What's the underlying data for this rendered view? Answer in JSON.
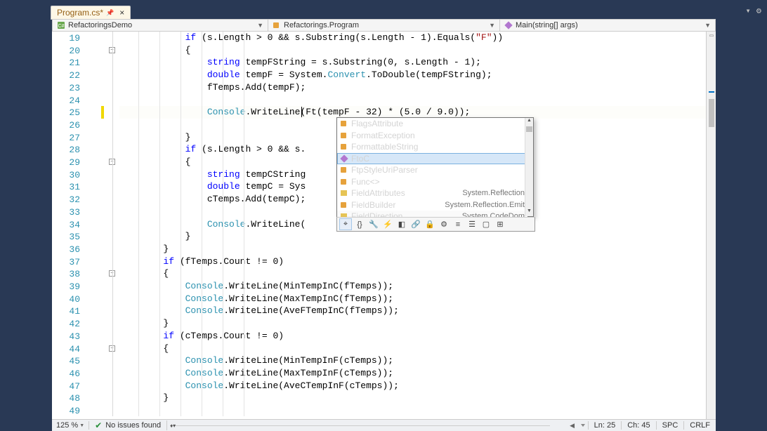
{
  "tab": {
    "name": "Program.cs*",
    "modified": true
  },
  "breadcrumb": {
    "namespace": "RefactoringsDemo",
    "class": "Refactorings.Program",
    "method": "Main(string[] args)"
  },
  "zoom": "125 %",
  "issues": "No issues found",
  "status": {
    "line_label": "Ln:",
    "line": "25",
    "col_label": "Ch:",
    "col": "45",
    "spc": "SPC",
    "crlf": "CRLF"
  },
  "code": {
    "19": "            if (s.Length > 0 && s.Substring(s.Length - 1).Equals(\"F\"))",
    "20": "            {",
    "21": "                string tempFString = s.Substring(0, s.Length - 1);",
    "22": "                double tempF = System.Convert.ToDouble(tempFString);",
    "23": "                fTemps.Add(tempF);",
    "24": "",
    "25": "                Console.WriteLine(Ft|(tempF - 32) * (5.0 / 9.0));",
    "26": "",
    "27": "            }",
    "28": "            if (s.Length > 0 && s.",
    "29": "            {",
    "30": "                string tempCString",
    "31": "                double tempC = Sys",
    "32": "                cTemps.Add(tempC);",
    "33": "",
    "34": "                Console.WriteLine(",
    "35": "            }",
    "36": "        }",
    "37": "        if (fTemps.Count != 0)",
    "38": "        {",
    "39": "            Console.WriteLine(MinTempInC(fTemps));",
    "40": "            Console.WriteLine(MaxTempInC(fTemps));",
    "41": "            Console.WriteLine(AveFTempInC(fTemps));",
    "42": "        }",
    "43": "        if (cTemps.Count != 0)",
    "44": "        {",
    "45": "            Console.WriteLine(MinTempInF(cTemps));",
    "46": "            Console.WriteLine(MaxTempInF(cTemps));",
    "47": "            Console.WriteLine(AveCTempInF(cTemps));",
    "48": "        }",
    "49": ""
  },
  "completion": {
    "items": [
      {
        "label": "FlagsAttribute",
        "icon": "class"
      },
      {
        "label": "FormatException",
        "icon": "class"
      },
      {
        "label": "FormattableString",
        "icon": "class"
      },
      {
        "label": "FtoC",
        "icon": "method",
        "selected": true
      },
      {
        "label": "FtpStyleUriParser",
        "icon": "class"
      },
      {
        "label": "Func<>",
        "icon": "class"
      },
      {
        "label": "FieldAttributes",
        "icon": "enum",
        "ns": "System.Reflection"
      },
      {
        "label": "FieldBuilder",
        "icon": "class",
        "ns": "System.Reflection.Emit"
      },
      {
        "label": "FieldDirection",
        "icon": "enum",
        "ns": "System.CodeDom",
        "partial": true
      }
    ],
    "toolbar_icons": [
      "target",
      "braces",
      "wrench",
      "event",
      "method-cube",
      "link",
      "lock",
      "gear",
      "list",
      "lines",
      "box",
      "grid"
    ]
  }
}
